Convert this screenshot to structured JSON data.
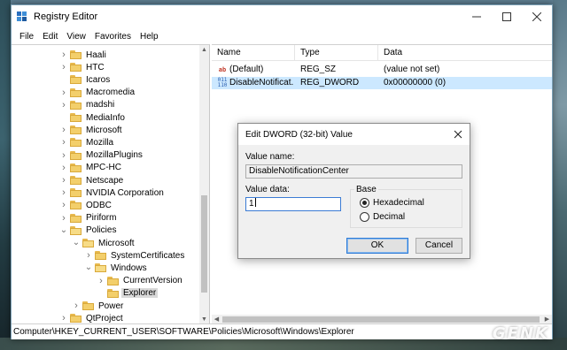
{
  "window": {
    "title": "Registry Editor",
    "controls": {
      "minimize": "minimize",
      "maximize": "maximize",
      "close": "close"
    }
  },
  "menu": [
    "File",
    "Edit",
    "View",
    "Favorites",
    "Help"
  ],
  "tree": [
    {
      "label": "Haali",
      "depth": 3,
      "expand": "collapsed"
    },
    {
      "label": "HTC",
      "depth": 3,
      "expand": "collapsed"
    },
    {
      "label": "Icaros",
      "depth": 3,
      "expand": "none"
    },
    {
      "label": "Macromedia",
      "depth": 3,
      "expand": "collapsed"
    },
    {
      "label": "madshi",
      "depth": 3,
      "expand": "collapsed"
    },
    {
      "label": "MediaInfo",
      "depth": 3,
      "expand": "none"
    },
    {
      "label": "Microsoft",
      "depth": 3,
      "expand": "collapsed"
    },
    {
      "label": "Mozilla",
      "depth": 3,
      "expand": "collapsed"
    },
    {
      "label": "MozillaPlugins",
      "depth": 3,
      "expand": "collapsed"
    },
    {
      "label": "MPC-HC",
      "depth": 3,
      "expand": "collapsed"
    },
    {
      "label": "Netscape",
      "depth": 3,
      "expand": "collapsed"
    },
    {
      "label": "NVIDIA Corporation",
      "depth": 3,
      "expand": "collapsed"
    },
    {
      "label": "ODBC",
      "depth": 3,
      "expand": "collapsed"
    },
    {
      "label": "Piriform",
      "depth": 3,
      "expand": "collapsed"
    },
    {
      "label": "Policies",
      "depth": 3,
      "expand": "expanded"
    },
    {
      "label": "Microsoft",
      "depth": 4,
      "expand": "expanded"
    },
    {
      "label": "SystemCertificates",
      "depth": 5,
      "expand": "collapsed"
    },
    {
      "label": "Windows",
      "depth": 5,
      "expand": "expanded"
    },
    {
      "label": "CurrentVersion",
      "depth": 6,
      "expand": "collapsed"
    },
    {
      "label": "Explorer",
      "depth": 6,
      "expand": "none",
      "selected": true
    },
    {
      "label": "Power",
      "depth": 4,
      "expand": "collapsed"
    },
    {
      "label": "QtProject",
      "depth": 3,
      "expand": "collapsed"
    }
  ],
  "list": {
    "columns": [
      "Name",
      "Type",
      "Data"
    ],
    "rows": [
      {
        "icon": "string-value-icon",
        "glyph": "ab",
        "name": "(Default)",
        "type": "REG_SZ",
        "data": "(value not set)",
        "selected": false
      },
      {
        "icon": "dword-value-icon",
        "glyph": "011\n110",
        "name": "DisableNotificat...",
        "type": "REG_DWORD",
        "data": "0x00000000 (0)",
        "selected": true
      }
    ]
  },
  "status_path": "Computer\\HKEY_CURRENT_USER\\SOFTWARE\\Policies\\Microsoft\\Windows\\Explorer",
  "dialog": {
    "title": "Edit DWORD (32-bit) Value",
    "value_name_label": "Value name:",
    "value_name": "DisableNotificationCenter",
    "value_data_label": "Value data:",
    "value_data": "1",
    "base_label": "Base",
    "base_options": [
      {
        "label": "Hexadecimal",
        "checked": true
      },
      {
        "label": "Decimal",
        "checked": false
      }
    ],
    "ok_label": "OK",
    "cancel_label": "Cancel"
  },
  "watermark": "GENK"
}
